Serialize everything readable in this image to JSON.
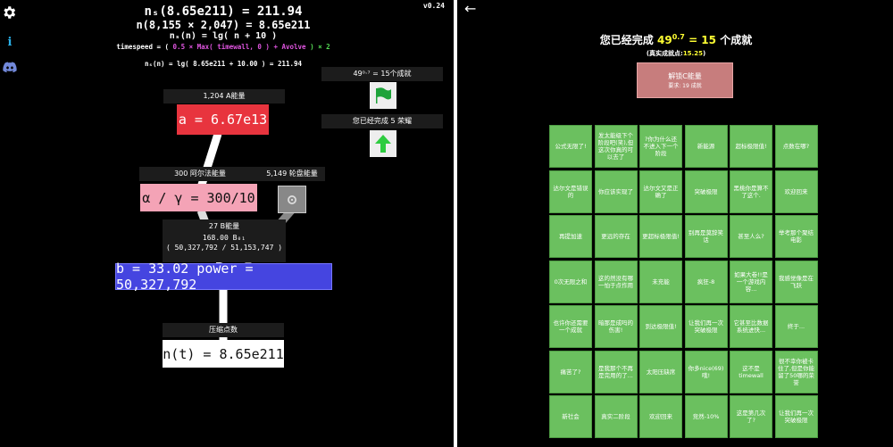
{
  "version": "v0.24",
  "header": {
    "ns_line": "nₛ(8.65e211) = 211.94",
    "n_line": "n(8,155 × 2,047) = 8.65e211",
    "formula": "nₛ(n) = lg( n + 10 )",
    "timespeed_prefix": "timespeed = (",
    "timespeed_mid": "0.5 × Max( timewall, 0 )",
    "timespeed_plus": "+",
    "timespeed_avolve": "Avolve",
    "timespeed_suffix": ") × 2",
    "ns_detail": "nₛ(n) = lg( 8.65e211 + 10.00 ) = 211.94"
  },
  "a_node": {
    "energy": "1,204 A能量",
    "value": "a = 6.67e13"
  },
  "alpha_node": {
    "energy": "300 阿尔法能量",
    "value": "α / γ = 300/10"
  },
  "wheel_node": {
    "energy": "5,149 轮盘能量",
    "icon": "gear-icon"
  },
  "b_node": {
    "energy": "27 B能量",
    "b01": "168.00 B₀₁",
    "b01_detail": "( 50,327,792 / 51,153,747 )",
    "value": "b = 33.02 power = 50,327,792"
  },
  "n_node": {
    "label": "压缩点数",
    "value": "n(t) = 8.65e211"
  },
  "left_achievements": {
    "label_prefix": "您已经完成",
    "count_label": "49⁰·⁷ = 15个成就",
    "honor_label": "您已经完成 5 荣耀"
  },
  "right": {
    "back_label": "←",
    "title_prefix": "您已经完成",
    "title_base": "49",
    "title_exp": "0.7",
    "title_eq": "= 15",
    "title_suffix": "个成就",
    "real_points_label": "(真实成就点:",
    "real_points_value": "15.25",
    "real_points_close": ")",
    "unlock_button": {
      "title": "解锁C能量",
      "sub": "要求: 19 成就"
    },
    "achievements": [
      "公式无限了!",
      "发太能级下个阶段吧(笑),但这次你真的可以去了",
      "?你为什么还不进入下一个阶段",
      "新能源",
      "超标极限值!",
      "点数在哪?",
      "达尔文是错误的",
      "你应该实现了",
      "达尔文又是正确了",
      "突破极限",
      "黑桃你是算不了这个.",
      "欢迎回来",
      "再提加速",
      "更远的存在",
      "更超标极限值!",
      "别再是莫辞笑话",
      "甚至人么?",
      "举考那个聚结电影",
      "0次无限之和",
      "这的然没有哪一怕于点作用",
      "未充能",
      "疯狂-8",
      "如果大卷!!是一个游戏内容...",
      "我感觉像是在飞跃",
      "也许你还需要一个成就",
      "暗那是成吗的伤害!",
      "到达极限值!",
      "让我们再一次突破极限",
      "它甚至比数据系统进快...",
      "终于...",
      "痛苦了?",
      "是我那个不再是完用的了...",
      "太阳压缺席",
      "你多nice(69)哦!",
      "这不是timewall",
      "很不幸你被卡住了,但是你能留了50哪的荣誉",
      "新社会",
      "真实二阶段",
      "欢迎回来",
      "竞然-10%",
      "这是第几次了?",
      "让我们再一次突破极限"
    ]
  },
  "colors": {
    "a_red": "#e8343e",
    "alpha_pink": "#f4a3b6",
    "b_blue": "#4545e0",
    "wheel_gray": "#888888",
    "achievement_green": "#6bc05f",
    "unlock_button": "#c77d7d",
    "highlight_yellow": "#ffff33",
    "timespeed_pink": "#e055e0",
    "timespeed_green": "#55dd55"
  }
}
